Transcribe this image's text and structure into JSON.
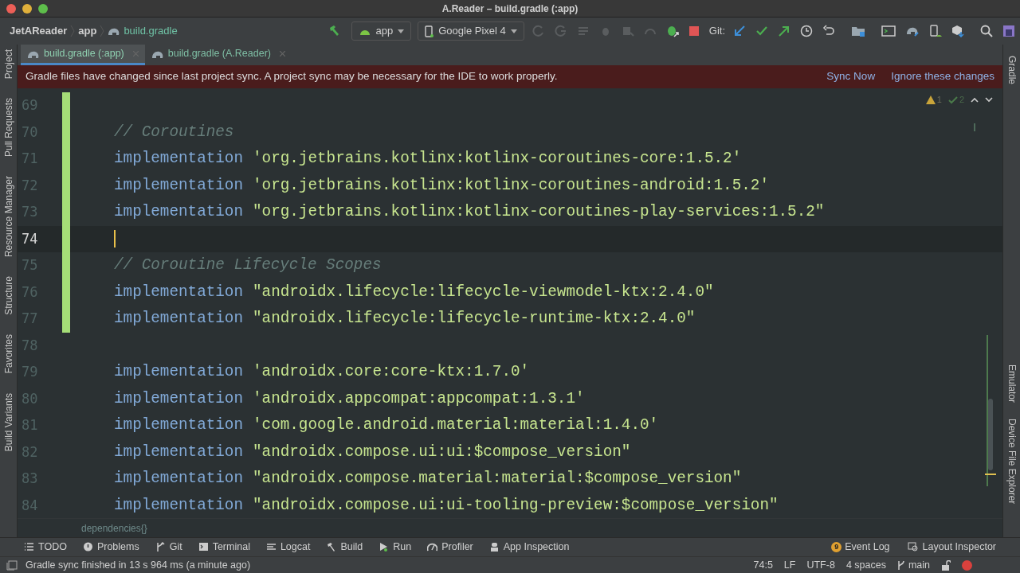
{
  "window": {
    "title": "A.Reader – build.gradle (:app)"
  },
  "navbar": {
    "breadcrumbs": [
      "JetAReader",
      "app",
      "build.gradle"
    ],
    "run_config": "app",
    "device": "Google Pixel 4",
    "git_label": "Git:"
  },
  "tabs": [
    {
      "label": "build.gradle (:app)",
      "selected": true
    },
    {
      "label": "build.gradle (A.Reader)",
      "selected": false
    }
  ],
  "banner": {
    "message": "Gradle files have changed since last project sync. A project sync may be necessary for the IDE to work properly.",
    "actions": [
      "Sync Now",
      "Ignore these changes"
    ]
  },
  "left_tool_windows": [
    "Project",
    "Pull Requests",
    "Resource Manager",
    "Structure",
    "Favorites",
    "Build Variants"
  ],
  "right_tool_windows": [
    "Gradle",
    "Emulator",
    "Device File Explorer"
  ],
  "inspections": {
    "warnings": "1",
    "weak_warnings": "2"
  },
  "editor": {
    "lines": [
      {
        "number": "69",
        "current": false,
        "changed": true
      },
      {
        "number": "70",
        "current": false,
        "changed": true,
        "tokens": [
          {
            "kind": "comment",
            "text": "// Coroutines"
          }
        ]
      },
      {
        "number": "71",
        "current": false,
        "changed": true,
        "tokens": [
          {
            "kind": "keyword",
            "text": "implementation"
          },
          {
            "kind": "string",
            "text": "'org.jetbrains.kotlinx:kotlinx-coroutines-core:1.5.2'"
          }
        ]
      },
      {
        "number": "72",
        "current": false,
        "changed": true,
        "tokens": [
          {
            "kind": "keyword",
            "text": "implementation"
          },
          {
            "kind": "string",
            "text": "'org.jetbrains.kotlinx:kotlinx-coroutines-android:1.5.2'"
          }
        ]
      },
      {
        "number": "73",
        "current": false,
        "changed": true,
        "tokens": [
          {
            "kind": "keyword",
            "text": "implementation"
          },
          {
            "kind": "string",
            "text": "\"org.jetbrains.kotlinx:kotlinx-coroutines-play-services:1.5.2\""
          }
        ]
      },
      {
        "number": "74",
        "current": true,
        "changed": true
      },
      {
        "number": "75",
        "current": false,
        "changed": true,
        "tokens": [
          {
            "kind": "comment",
            "text": "// Coroutine Lifecycle Scopes"
          }
        ]
      },
      {
        "number": "76",
        "current": false,
        "changed": true,
        "tokens": [
          {
            "kind": "keyword",
            "text": "implementation"
          },
          {
            "kind": "string",
            "text": "\"androidx.lifecycle:lifecycle-viewmodel-ktx:2.4.0\""
          }
        ]
      },
      {
        "number": "77",
        "current": false,
        "changed": true,
        "tokens": [
          {
            "kind": "keyword",
            "text": "implementation"
          },
          {
            "kind": "string",
            "text": "\"androidx.lifecycle:lifecycle-runtime-ktx:2.4.0\""
          }
        ]
      },
      {
        "number": "78",
        "current": false,
        "changed": false
      },
      {
        "number": "79",
        "current": false,
        "changed": false,
        "tokens": [
          {
            "kind": "keyword",
            "text": "implementation"
          },
          {
            "kind": "string",
            "text": "'androidx.core:core-ktx:1.7.0'"
          }
        ]
      },
      {
        "number": "80",
        "current": false,
        "changed": false,
        "tokens": [
          {
            "kind": "keyword",
            "text": "implementation"
          },
          {
            "kind": "string",
            "text": "'androidx.appcompat:appcompat:1.3.1'"
          }
        ]
      },
      {
        "number": "81",
        "current": false,
        "changed": false,
        "tokens": [
          {
            "kind": "keyword",
            "text": "implementation"
          },
          {
            "kind": "string",
            "text": "'com.google.android.material:material:1.4.0'"
          }
        ]
      },
      {
        "number": "82",
        "current": false,
        "changed": false,
        "tokens": [
          {
            "kind": "keyword",
            "text": "implementation"
          },
          {
            "kind": "string",
            "text": "\"androidx.compose.ui:ui:$compose_version\""
          }
        ]
      },
      {
        "number": "83",
        "current": false,
        "changed": false,
        "tokens": [
          {
            "kind": "keyword",
            "text": "implementation"
          },
          {
            "kind": "string",
            "text": "\"androidx.compose.material:material:$compose_version\""
          }
        ]
      },
      {
        "number": "84",
        "current": false,
        "changed": false,
        "tokens": [
          {
            "kind": "keyword",
            "text": "implementation"
          },
          {
            "kind": "string",
            "text": "\"androidx.compose.ui:ui-tooling-preview:$compose_version\""
          }
        ]
      }
    ],
    "breadcrumb": "dependencies{}"
  },
  "bottom_tools": [
    {
      "label": "TODO"
    },
    {
      "label": "Problems"
    },
    {
      "label": "Git"
    },
    {
      "label": "Terminal"
    },
    {
      "label": "Logcat"
    },
    {
      "label": "Build"
    },
    {
      "label": "Run"
    },
    {
      "label": "Profiler"
    },
    {
      "label": "App Inspection"
    }
  ],
  "event_log": {
    "label": "Event Log",
    "badge": "9"
  },
  "layout_inspector": {
    "label": "Layout Inspector"
  },
  "status_bar": {
    "message": "Gradle sync finished in 13 s 964 ms (a minute ago)",
    "position": "74:5",
    "line_separator": "LF",
    "encoding": "UTF-8",
    "indent": "4 spaces",
    "branch": "main"
  }
}
